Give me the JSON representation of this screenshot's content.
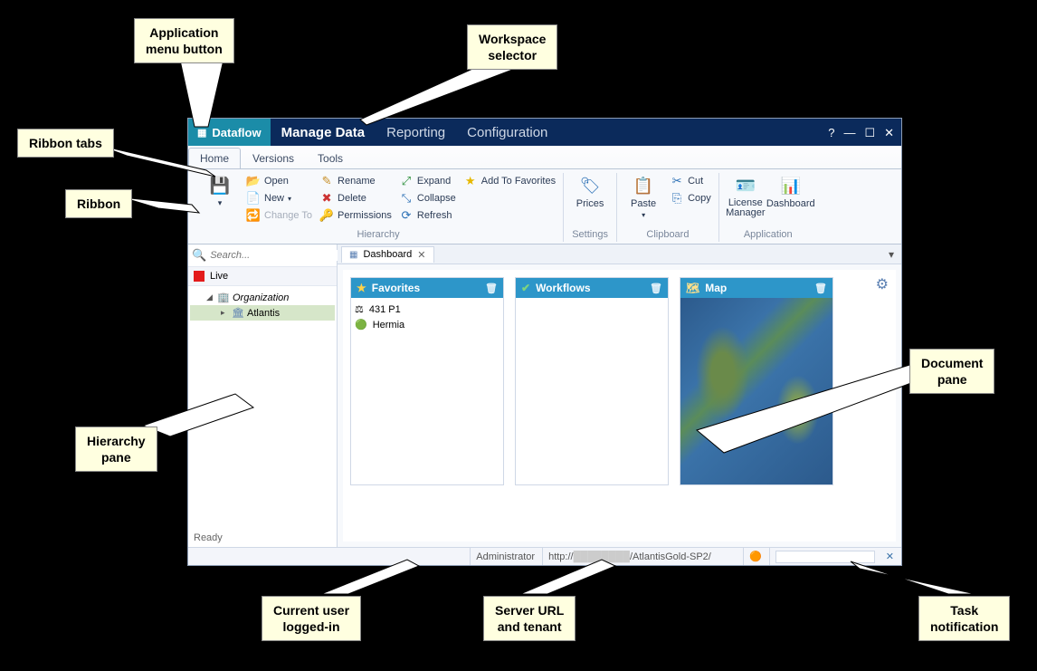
{
  "callouts": {
    "appmenu": "Application\nmenu button",
    "workspace": "Workspace\nselector",
    "ribbontabs": "Ribbon tabs",
    "ribbon": "Ribbon",
    "hierarchy": "Hierarchy\npane",
    "document": "Document\npane",
    "user": "Current user\nlogged-in",
    "server": "Server URL\nand tenant",
    "task": "Task\nnotification"
  },
  "app": {
    "menu_label": "Dataflow",
    "workspaces": [
      "Manage Data",
      "Reporting",
      "Configuration"
    ],
    "active_workspace": 0
  },
  "ribbon": {
    "tabs": [
      "Home",
      "Versions",
      "Tools"
    ],
    "active_tab": 0,
    "groups": {
      "hierarchy_label": "Hierarchy",
      "settings_label": "Settings",
      "clipboard_label": "Clipboard",
      "application_label": "Application"
    },
    "btns": {
      "open": "Open",
      "new": "New",
      "change_to": "Change To",
      "rename": "Rename",
      "delete": "Delete",
      "permissions": "Permissions",
      "expand": "Expand",
      "collapse": "Collapse",
      "refresh": "Refresh",
      "add_fav": "Add To Favorites",
      "prices": "Prices",
      "paste": "Paste",
      "cut": "Cut",
      "copy": "Copy",
      "license": "License\nManager",
      "dashboard": "Dashboard"
    }
  },
  "sidebar": {
    "search_placeholder": "Search...",
    "live": "Live",
    "tree": {
      "root": "Organization",
      "child": "Atlantis"
    },
    "ready": "Ready"
  },
  "doc": {
    "tab": "Dashboard",
    "favorites": {
      "title": "Favorites",
      "items": [
        "431 P1",
        "Hermia"
      ]
    },
    "workflows": {
      "title": "Workflows"
    },
    "map": {
      "title": "Map"
    }
  },
  "status": {
    "user": "Administrator",
    "url_prefix": "http://",
    "tenant": "/AtlantisGold-SP2/"
  }
}
